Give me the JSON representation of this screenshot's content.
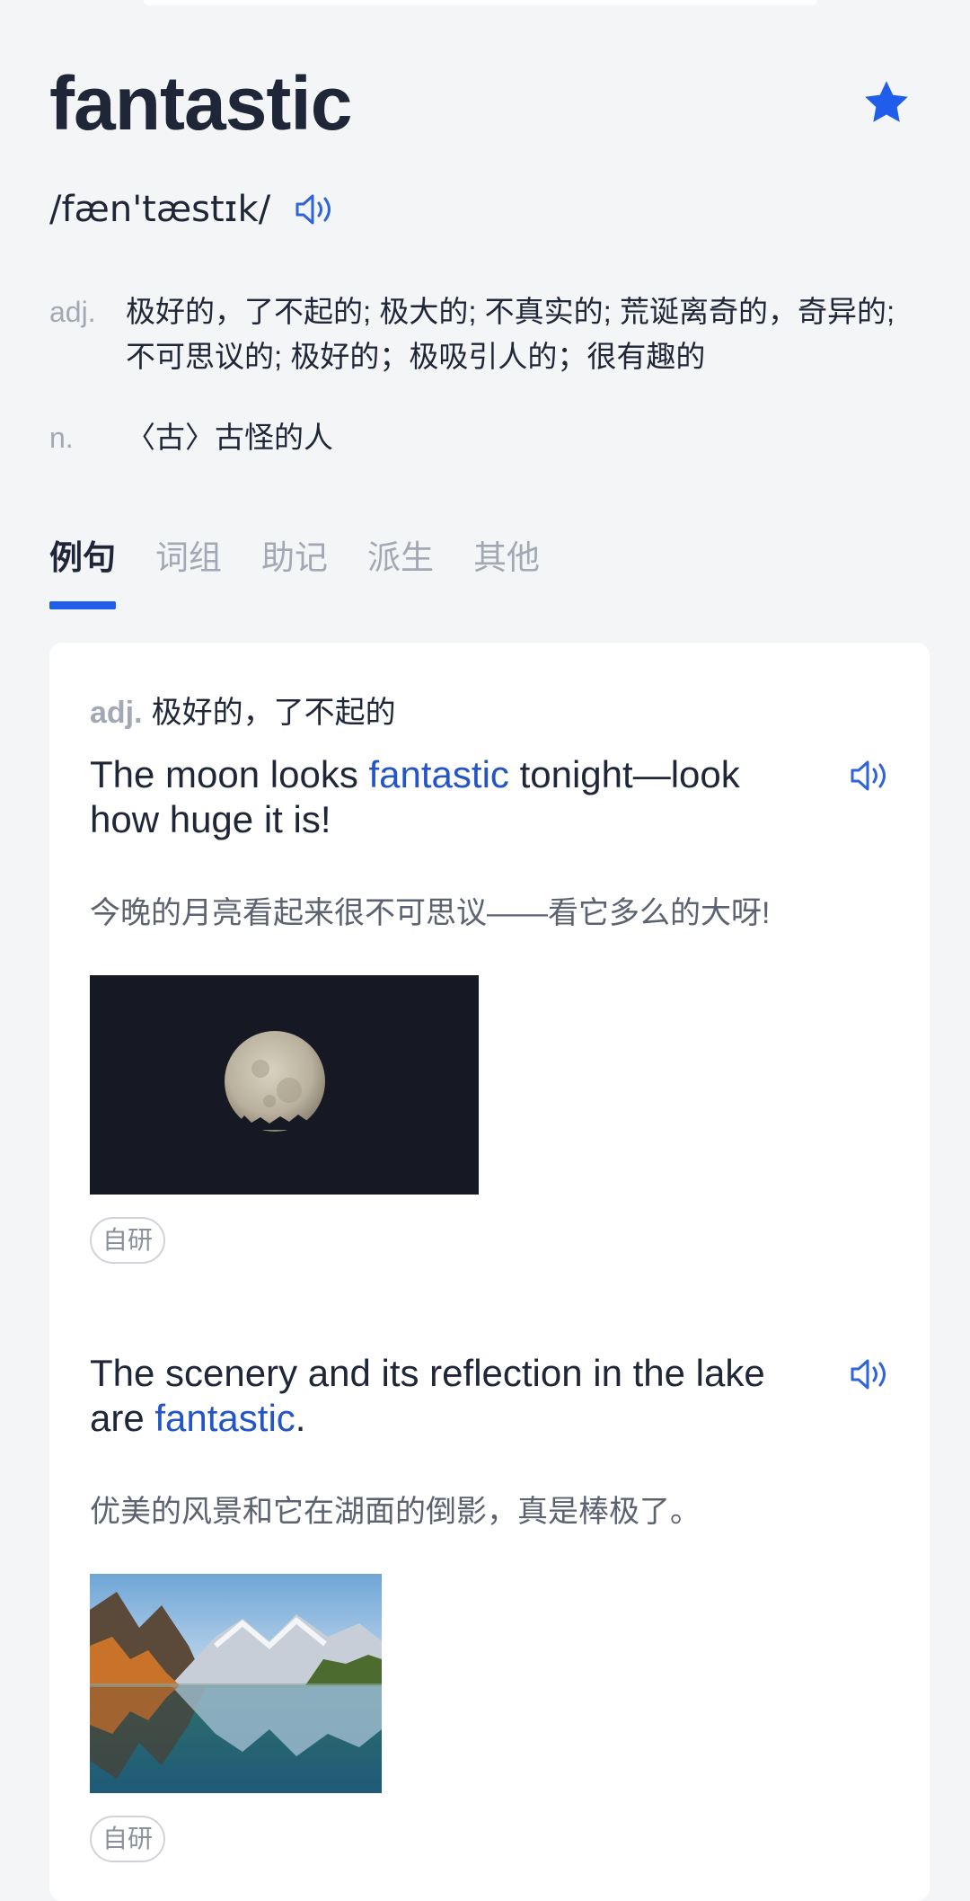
{
  "word": "fantastic",
  "phonetic": "/fæn'tæstɪk/",
  "definitions": [
    {
      "pos": "adj.",
      "meaning": "极好的，了不起的; 极大的; 不真实的; 荒诞离奇的，奇异的; 不可思议的; 极好的；极吸引人的；很有趣的"
    },
    {
      "pos": "n.",
      "meaning": "〈古〉古怪的人"
    }
  ],
  "tabs": [
    "例句",
    "词组",
    "助记",
    "派生",
    "其他"
  ],
  "active_tab": "例句",
  "sense": {
    "pos": "adj.",
    "meaning": "极好的，了不起的"
  },
  "examples": [
    {
      "en_before": "The moon looks ",
      "en_highlight": "fantastic",
      "en_after": " tonight—look how huge it is!",
      "zh": "今晚的月亮看起来很不可思议——看它多么的大呀!",
      "image": "full-moon-night-photo",
      "tag": "自研"
    },
    {
      "en_before": "The scenery and its reflection in the lake are ",
      "en_highlight": "fantastic",
      "en_after": ".",
      "zh": "优美的风景和它在湖面的倒影，真是棒极了。",
      "image": "mountain-lake-reflection-photo",
      "tag": "自研"
    }
  ],
  "colors": {
    "accent": "#1f5dea",
    "highlight": "#2355c7",
    "muted": "#a2a8b4",
    "background": "#f4f5f7"
  }
}
